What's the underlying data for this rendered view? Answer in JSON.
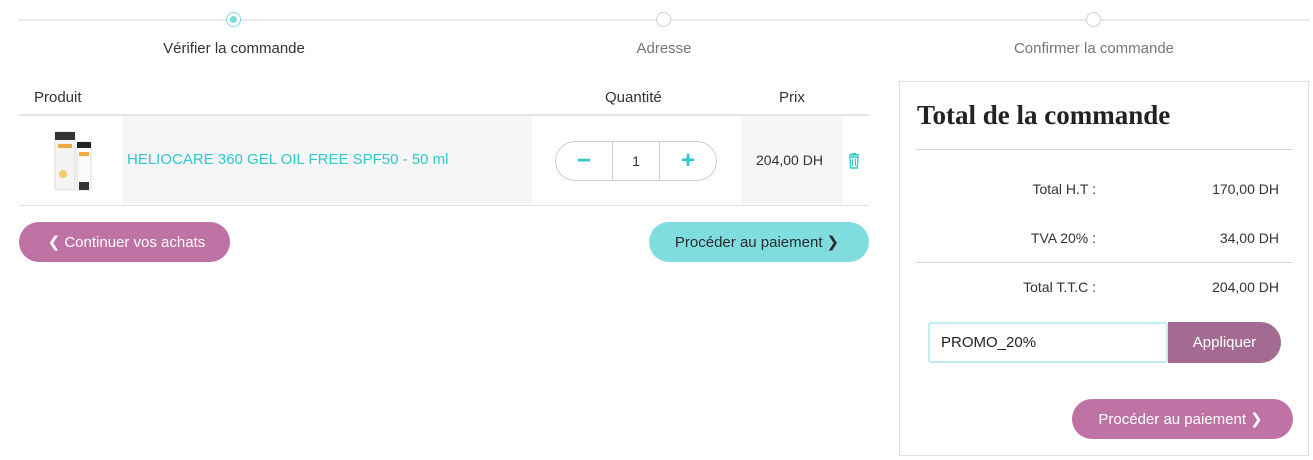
{
  "stepper": {
    "steps": [
      {
        "label": "Vérifier la commande",
        "active": true
      },
      {
        "label": "Adresse",
        "active": false
      },
      {
        "label": "Confirmer la commande",
        "active": false
      }
    ]
  },
  "cart": {
    "headers": {
      "product": "Produit",
      "quantity": "Quantité",
      "price": "Prix"
    },
    "items": [
      {
        "name": "HELIOCARE 360 GEL OIL FREE SPF50 - 50 ml",
        "quantity": "1",
        "price": "204,00 DH",
        "decrement": "−",
        "increment": "+"
      }
    ],
    "continue_label": "Continuer vos achats",
    "checkout_label": "Procéder au paiement"
  },
  "summary": {
    "title": "Total de la commande",
    "ht_label": "Total H.T :",
    "ht_value": "170,00 DH",
    "tva_label": "TVA 20% :",
    "tva_value": "34,00 DH",
    "ttc_label": "Total T.T.C :",
    "ttc_value": "204,00 DH",
    "promo_value": "PROMO_20%",
    "apply_label": "Appliquer",
    "checkout_label": "Procéder au paiement"
  },
  "colors": {
    "accent_teal": "#2ec8cf",
    "button_teal": "#7fdde0",
    "button_mauve": "#bf72a4",
    "apply_mauve": "#a36b91"
  },
  "icons": [
    "chevron-left-icon",
    "chevron-right-icon",
    "trash-icon",
    "minus-icon",
    "plus-icon"
  ]
}
